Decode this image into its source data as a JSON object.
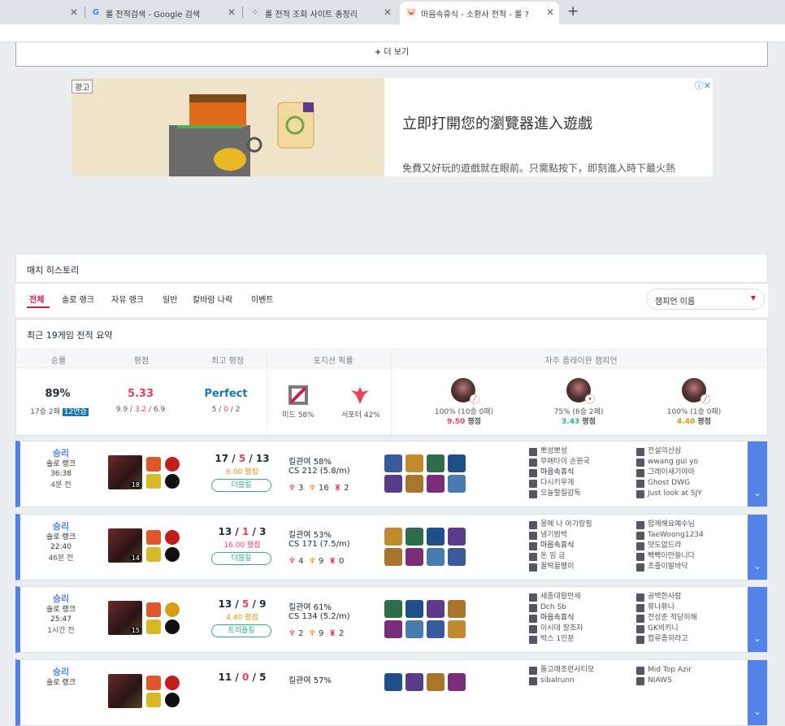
{
  "browser": {
    "tabs": [
      {
        "title": "롤 전적검색 - Google 검색",
        "favicon": "google-g"
      },
      {
        "title": "롤 전적 조회 사이트 총정리",
        "favicon": "dots"
      },
      {
        "title": "마음속휴식 - 소환사 전적 - 롤 ?",
        "favicon": "pig",
        "active": true
      }
    ],
    "new_tab": "+"
  },
  "more_button": "더 보기",
  "ad": {
    "label": "광고",
    "title": "立即打開您的瀏覽器進入遊戲",
    "desc": "免費又好玩的遊戲就在眼前。只需點按下，即刻進入時下最火熱",
    "close": "ⓘ✕"
  },
  "match_history": {
    "title": "매치 히스토리",
    "filters": [
      "전체",
      "솔로 랭크",
      "자유 랭크",
      "일반",
      "칼바람 나락",
      "이벤트"
    ],
    "champion_placeholder": "챔피언 이름"
  },
  "summary": {
    "title": "최근 19게임 전적 요약",
    "headers": {
      "winrate": "승률",
      "kda": "평점",
      "best": "최고 평점",
      "positions": "포지션 픽률",
      "champions": "자주 플레이한 챔피언"
    },
    "winrate": "89%",
    "record": "17승 2패",
    "streak": "12연승",
    "kda": "5.33",
    "kda_k": "9.9",
    "kda_d": "3.2",
    "kda_a": "6.9",
    "best": "Perfect",
    "best_k": "5",
    "best_d": "0",
    "best_a": "2",
    "positions": [
      {
        "label": "미드 58%"
      },
      {
        "label": "서포터 42%"
      }
    ],
    "champions": [
      {
        "rate": "100% (10승 0패)",
        "kda": "9.50",
        "kda_label": "평점"
      },
      {
        "rate": "75% (6승 2패)",
        "kda": "3.43",
        "kda_label": "평점"
      },
      {
        "rate": "100% (1승 0패)",
        "kda": "4.40",
        "kda_label": "평점"
      }
    ]
  },
  "matches": [
    {
      "result": "승리",
      "queue": "솔로 랭크",
      "duration": "36:38",
      "ago": "4분 전",
      "level": "18",
      "kills": "17",
      "deaths": "5",
      "assists": "13",
      "rating": "6.00 평점",
      "badge": "더블킬",
      "kp": "킬관여 58%",
      "cs": "CS 212 (5.8/m)",
      "obj": [
        "3",
        "16",
        "2"
      ],
      "team1": [
        "뽀성뽀성",
        "무에타이 손원국",
        "마음속휴식",
        "다시키우게",
        "오늘할킬감독"
      ],
      "team2": [
        "전설의산삼",
        "wwang gui yo",
        "그레이새기야아",
        "Ghost DWG",
        "Just look at SJY"
      ]
    },
    {
      "result": "승리",
      "queue": "솔로 랭크",
      "duration": "22:40",
      "ago": "46분 전",
      "level": "14",
      "kills": "13",
      "deaths": "1",
      "assists": "3",
      "rating": "16.00 평점",
      "badge": "더블킬",
      "kp": "킬관여 53%",
      "cs": "CS 171 (7.5/m)",
      "obj": [
        "4",
        "9",
        "0"
      ],
      "team1": [
        "몽에 나 아기랑핑",
        "냉기범벅",
        "마음속휴식",
        "돈 임 금",
        "꿀떡꿀팽이"
      ],
      "team2": [
        "함께해요예수님",
        "TaeWoong1234",
        "맛도없드라",
        "빡빡이만쓸니다",
        "조졸이발바닥"
      ]
    },
    {
      "result": "승리",
      "queue": "솔로 랭크",
      "duration": "25:47",
      "ago": "1시간 전",
      "level": "15",
      "kills": "13",
      "deaths": "5",
      "assists": "9",
      "rating": "4.40 평점",
      "badge": "트리플킬",
      "kp": "킬관여 61%",
      "cs": "CS 134 (5.2/m)",
      "obj": [
        "2",
        "9",
        "2"
      ],
      "team1": [
        "세종대왕만세",
        "Dch Sb",
        "마음속휴식",
        "이시데 장조자",
        "박스 1인분"
      ],
      "team2": [
        "공백한사람",
        "쮸나쮸나",
        "전성준 적당히해",
        "GK비키니",
        "합류좀하라고"
      ]
    },
    {
      "result": "승리",
      "queue": "솔로 랭크",
      "duration": "",
      "ago": "",
      "level": "",
      "kills": "11",
      "deaths": "0",
      "assists": "5",
      "rating": "",
      "badge": "",
      "kp": "킬관여 57%",
      "cs": "",
      "obj": [
        "",
        "",
        ""
      ],
      "team1": [
        "돌고래조련사티모",
        "sibalrunn"
      ],
      "team2": [
        "Mid Top Azir",
        "NIAWS"
      ]
    }
  ],
  "colors": {
    "win": "#5383e8",
    "accent": "#d31a45",
    "streak": "#1a78ae"
  }
}
